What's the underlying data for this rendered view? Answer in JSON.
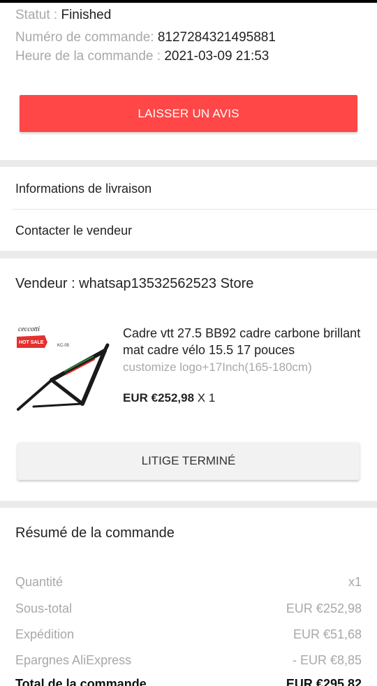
{
  "order": {
    "status_label": "Statut : ",
    "status_value": "Finished",
    "number_label": "Numéro de commande: ",
    "number_value": "8127284321495881",
    "time_label": "Heure de la commande : ",
    "time_value": "2021-03-09 21:53",
    "review_button": "LAISSER UN AVIS"
  },
  "links": {
    "delivery": "Informations de livraison",
    "contact": "Contacter le vendeur"
  },
  "seller": {
    "label": "Vendeur : whatsap13532562523 Store"
  },
  "product": {
    "image_brand": "ceccotti",
    "image_badge": "HOT SALE",
    "image_model": "KC-05",
    "title": "Cadre vtt 27.5 BB92 cadre carbone brillant mat cadre vélo 15.5 17 pouces",
    "variant": "customize logo+17Inch(165-180cm)",
    "price": "EUR €252,98",
    "quantity": " X 1",
    "dispute_button": "LITIGE TERMINÉ"
  },
  "summary": {
    "title": "Résumé de la commande",
    "rows": [
      {
        "label": "Quantité",
        "value": "x1"
      },
      {
        "label": "Sous-total",
        "value": "EUR €252,98"
      },
      {
        "label": "Expédition",
        "value": "EUR €51,68"
      },
      {
        "label": "Epargnes AliExpress",
        "value": "- EUR €8,85"
      },
      {
        "label": "Total de la commande",
        "value": "EUR €295,82"
      }
    ]
  },
  "colors": {
    "accent": "#ff4747",
    "background": "#ebebeb",
    "card": "#ffffff",
    "muted_text": "#a8a8a8"
  }
}
